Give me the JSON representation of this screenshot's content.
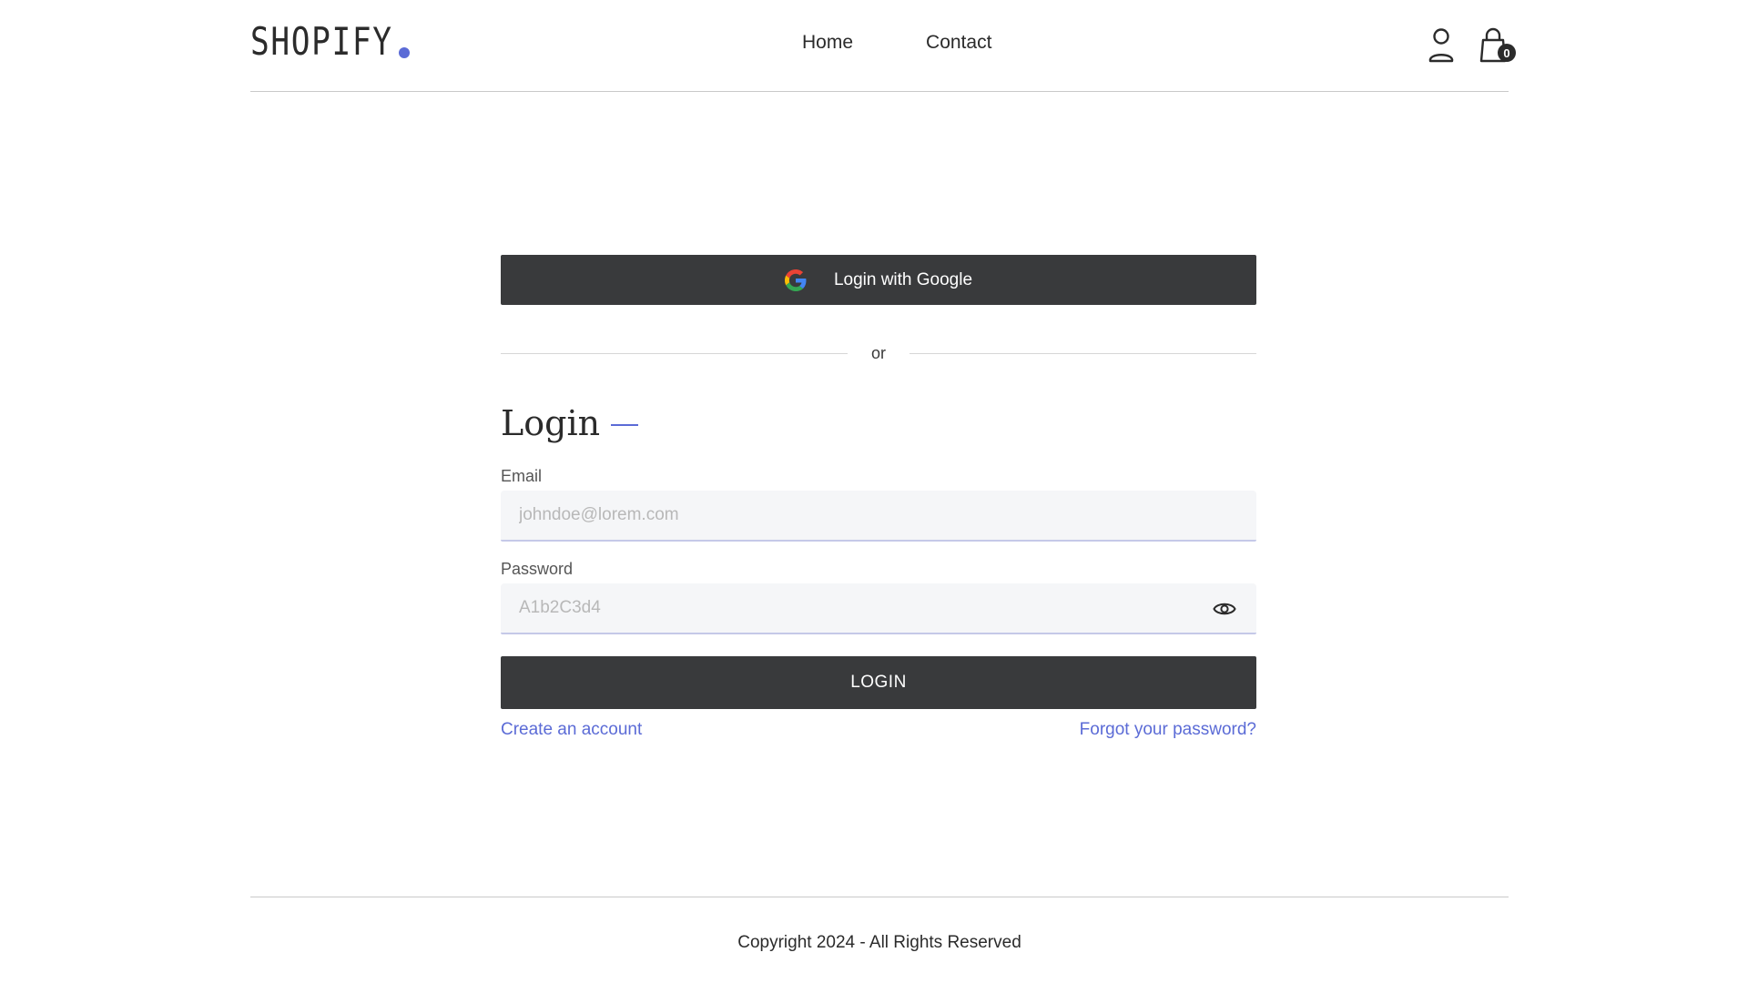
{
  "colors": {
    "accent": "#5b6bd6",
    "button_dark": "#393a3c",
    "text": "#2b2b2b"
  },
  "header": {
    "logo_text": "SHOPIFY",
    "nav": [
      {
        "label": "Home"
      },
      {
        "label": "Contact"
      }
    ],
    "icons": {
      "account": "user-icon",
      "cart": "shopping-bag-icon"
    },
    "cart_count": "0"
  },
  "auth": {
    "google_button_label": "Login with Google",
    "divider_text": "or",
    "title": "Login",
    "email": {
      "label": "Email",
      "placeholder": "johndoe@lorem.com",
      "value": ""
    },
    "password": {
      "label": "Password",
      "placeholder": "A1b2C3d4",
      "value": "",
      "toggle_icon": "eye-icon"
    },
    "login_button_label": "LOGIN",
    "create_account_link": "Create an account",
    "forgot_password_link": "Forgot your password?"
  },
  "footer": {
    "copyright": "Copyright 2024 - All Rights Reserved"
  }
}
